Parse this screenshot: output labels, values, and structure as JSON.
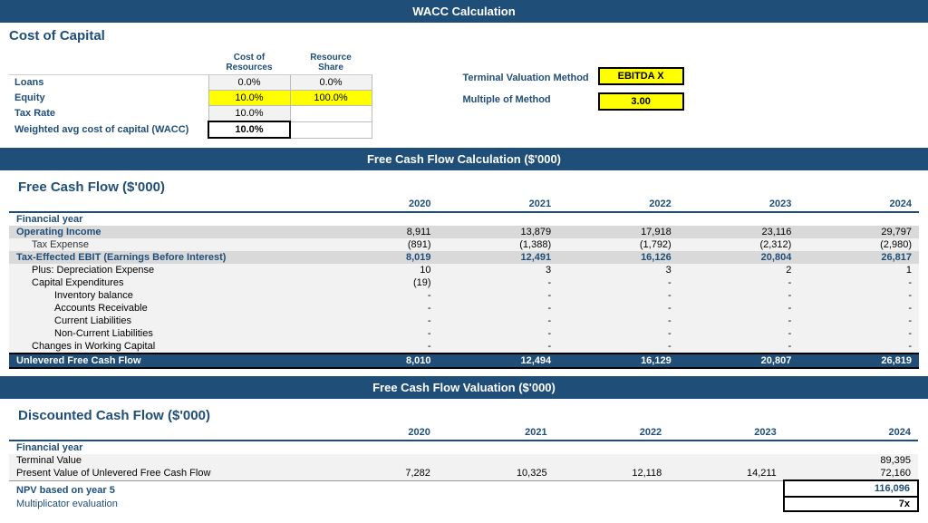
{
  "page": {
    "title": "WACC Calculation",
    "fcf_header": "Free Cash Flow Calculation ($'000)",
    "val_header": "Free Cash Flow Valuation ($'000)"
  },
  "wacc": {
    "section_title": "Cost of Capital",
    "col1": "Cost of Resources",
    "col2": "Resource Share",
    "rows": [
      {
        "label": "Loans",
        "cost": "0.0%",
        "share": "0.0%",
        "cost_style": "normal",
        "share_style": "normal"
      },
      {
        "label": "Equity",
        "cost": "10.0%",
        "share": "100.0%",
        "cost_style": "yellow",
        "share_style": "yellow"
      },
      {
        "label": "Tax Rate",
        "cost": "10.0%",
        "share": "",
        "cost_style": "normal",
        "share_style": ""
      },
      {
        "label": "Weighted avg cost of capital (WACC)",
        "cost": "10.0%",
        "share": "",
        "cost_style": "bold",
        "share_style": ""
      }
    ],
    "terminal": {
      "method_label": "Terminal Valuation Method",
      "multiple_label": "Multiple of Method",
      "method_value": "EBITDA X",
      "multiple_value": "3.00"
    }
  },
  "fcf": {
    "section_title": "Free Cash Flow ($'000)",
    "columns": [
      "",
      "2020",
      "2021",
      "2022",
      "2023",
      "2024"
    ],
    "rows": [
      {
        "label": "Financial year",
        "values": [
          "",
          "",
          "",
          "",
          ""
        ],
        "style": "bold"
      },
      {
        "label": "Operating Income",
        "values": [
          "8,911",
          "13,879",
          "17,918",
          "23,116",
          "29,797"
        ],
        "style": "shaded"
      },
      {
        "label": "Tax Expense",
        "values": [
          "(891)",
          "(1,388)",
          "(1,792)",
          "(2,312)",
          "(2,980)"
        ],
        "style": "indent1-light"
      },
      {
        "label": "Tax-Effected EBIT (Earnings Before Interest)",
        "values": [
          "8,019",
          "12,491",
          "16,126",
          "20,804",
          "26,817"
        ],
        "style": "bold-shaded"
      },
      {
        "label": "Plus: Depreciation Expense",
        "values": [
          "10",
          "3",
          "3",
          "2",
          "1"
        ],
        "style": "indent1-light"
      },
      {
        "label": "Capital Expenditures",
        "values": [
          "(19)",
          "-",
          "-",
          "-",
          "-"
        ],
        "style": "indent1-light"
      },
      {
        "label": "Inventory balance",
        "values": [
          "-",
          "-",
          "-",
          "-",
          "-"
        ],
        "style": "indent2-light"
      },
      {
        "label": "Accounts Receivable",
        "values": [
          "-",
          "-",
          "-",
          "-",
          "-"
        ],
        "style": "indent2-light"
      },
      {
        "label": "Current Liabilities",
        "values": [
          "-",
          "-",
          "-",
          "-",
          "-"
        ],
        "style": "indent2-light"
      },
      {
        "label": "Non-Current Liabilities",
        "values": [
          "-",
          "-",
          "-",
          "-",
          "-"
        ],
        "style": "indent2-light"
      },
      {
        "label": "Changes in Working Capital",
        "values": [
          "-",
          "-",
          "-",
          "-",
          "-"
        ],
        "style": "indent1-light"
      },
      {
        "label": "Unlevered Free Cash Flow",
        "values": [
          "8,010",
          "12,494",
          "16,129",
          "20,807",
          "26,819"
        ],
        "style": "total"
      }
    ]
  },
  "valuation": {
    "section_title": "Discounted Cash Flow ($'000)",
    "columns": [
      "",
      "2020",
      "2021",
      "2022",
      "2023",
      "2024"
    ],
    "rows": [
      {
        "label": "Financial year",
        "values": [
          "",
          "",
          "",
          "",
          ""
        ],
        "style": "bold"
      },
      {
        "label": "Terminal Value",
        "values": [
          "",
          "",
          "",
          "",
          "89,395"
        ],
        "style": "light"
      },
      {
        "label": "Present Value of Unlevered Free Cash Flow",
        "values": [
          "7,282",
          "10,325",
          "12,118",
          "14,211",
          "72,160"
        ],
        "style": "light"
      }
    ],
    "npv_label": "NPV based on year 5",
    "npv_value": "116,096",
    "mult_label": "Multiplicator evaluation",
    "mult_value": "7x"
  }
}
